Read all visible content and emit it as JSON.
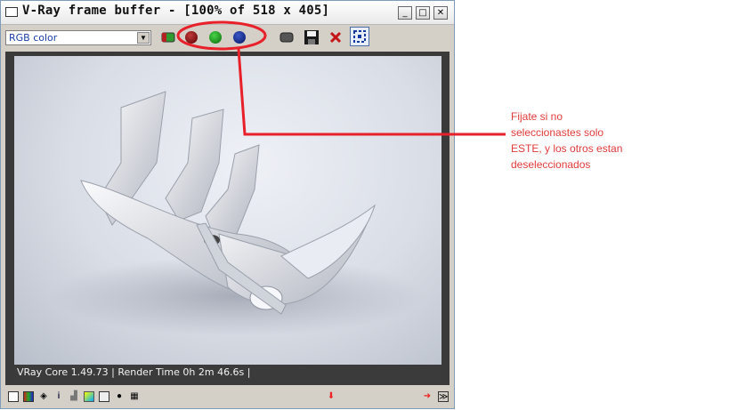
{
  "window": {
    "title": "V-Ray frame buffer - [100% of 518 x 405]",
    "minimize_icon": "minimize-icon",
    "maximize_icon": "maximize-icon",
    "close_icon": "close-icon"
  },
  "toolbar": {
    "channel_select": {
      "selected": "RGB color"
    },
    "buttons": [
      {
        "name": "rgb-channels-button",
        "icon": "rgb-icon"
      },
      {
        "name": "red-channel-button",
        "icon": "red-dot-icon",
        "color": "#8b0000"
      },
      {
        "name": "green-channel-button",
        "icon": "green-dot-icon",
        "color": "#0a8a0a"
      },
      {
        "name": "blue-channel-button",
        "icon": "blue-dot-icon",
        "color": "#08207a"
      },
      {
        "name": "alpha-channel-button",
        "icon": "alpha-icon"
      },
      {
        "name": "save-image-button",
        "icon": "save-icon"
      },
      {
        "name": "clear-image-button",
        "icon": "x-icon",
        "color": "#c41616"
      },
      {
        "name": "region-render-button",
        "icon": "region-icon"
      }
    ]
  },
  "render": {
    "status_text": "VRay Core 1.49.73 | Render Time 0h 2m 46.6s |"
  },
  "annotation": {
    "color": "#e8202a",
    "lines": [
      "Fijate si no",
      "seleccionastes solo",
      "ESTE, y los otros estan",
      "deseleccionados"
    ]
  }
}
